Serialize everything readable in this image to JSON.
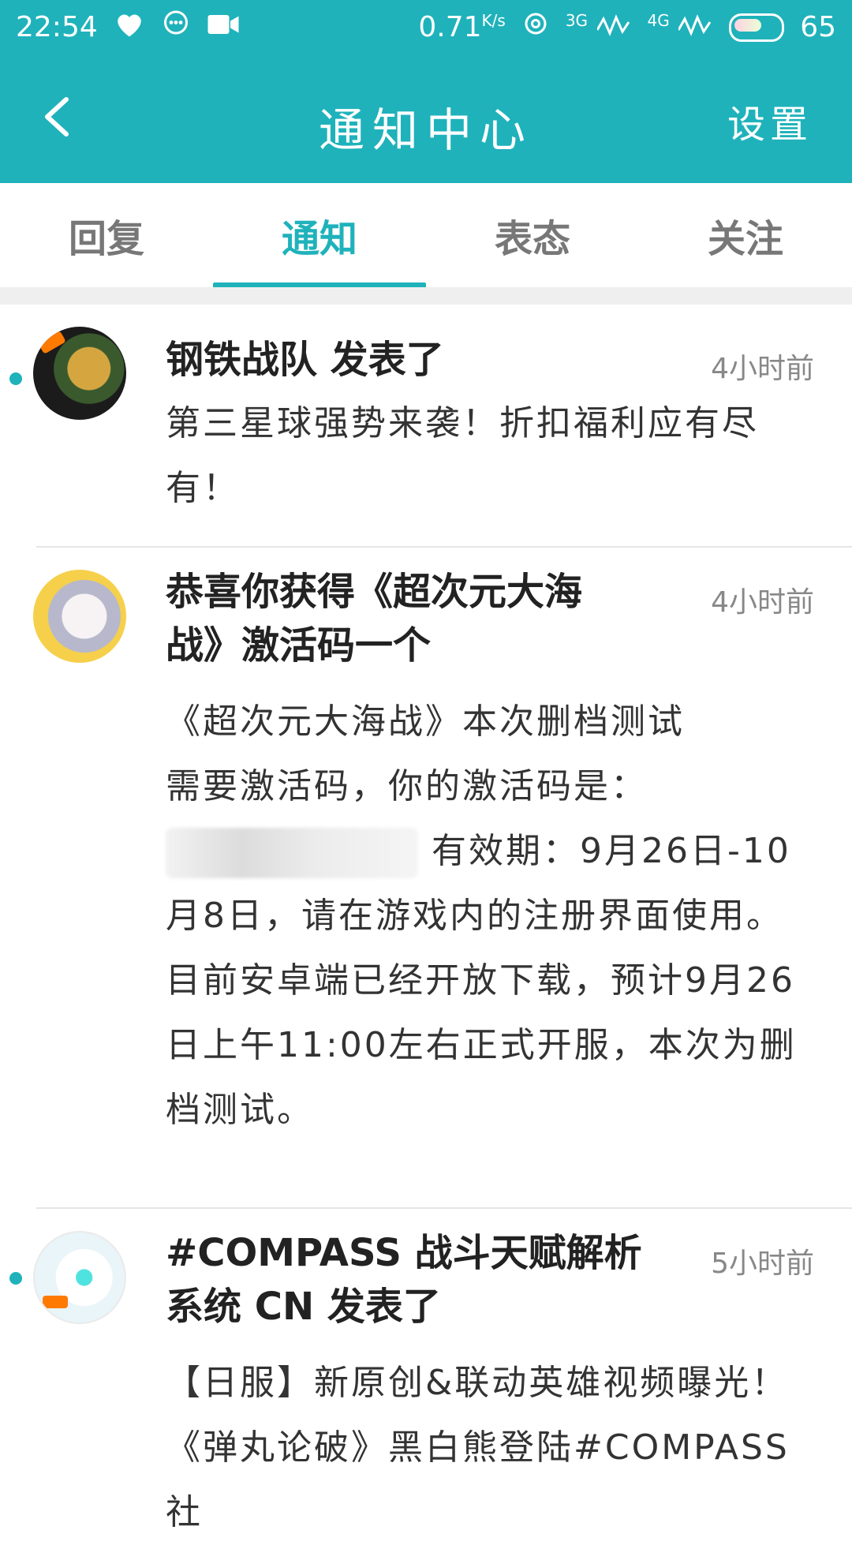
{
  "status_bar": {
    "time": "22:54",
    "speed": "0.71",
    "speed_unit": "K/s",
    "net1": "3G",
    "net2": "4G",
    "battery": "65",
    "icons": [
      "heart-icon",
      "chat-bubble-icon",
      "video-camera-icon",
      "settings-gear-icon",
      "battery-icon"
    ]
  },
  "appbar": {
    "title": "通知中心",
    "settings": "设置",
    "back_icon": "chevron-left-icon",
    "bg_color": "#1fb2bb"
  },
  "tabs": [
    {
      "label": "回复",
      "active": false
    },
    {
      "label": "通知",
      "active": true
    },
    {
      "label": "表态",
      "active": false
    },
    {
      "label": "关注",
      "active": false
    }
  ],
  "notifications": [
    {
      "title": "钢铁战队 发表了",
      "time": "4小时前",
      "body": "第三星球强势来袭！折扣福利应有尽有！",
      "unread": true
    },
    {
      "title": "恭喜你获得《超次元大海战》激活码一个",
      "time": "4小时前",
      "body_line1": "《超次元大海战》本次删档测试",
      "body_line2": "需要激活码，你的激活码是：",
      "body_line3_tail": "有效期：9月26日-10月8日，请在游戏内的注册界面使用。",
      "body_line4": "目前安卓端已经开放下载，预计9月26日上午11:00左右正式开服，本次为删档测试。",
      "unread": false
    },
    {
      "title": "#COMPASS 战斗天赋解析系统 CN 发表了",
      "time": "5小时前",
      "body": "【日服】新原创&联动英雄视频曝光！《弹丸论破》黑白熊登陆#COMPASS社",
      "unread": true
    }
  ],
  "colors": {
    "accent": "#1fb2bb",
    "tab_inactive": "#777777",
    "time_text": "#888888"
  }
}
